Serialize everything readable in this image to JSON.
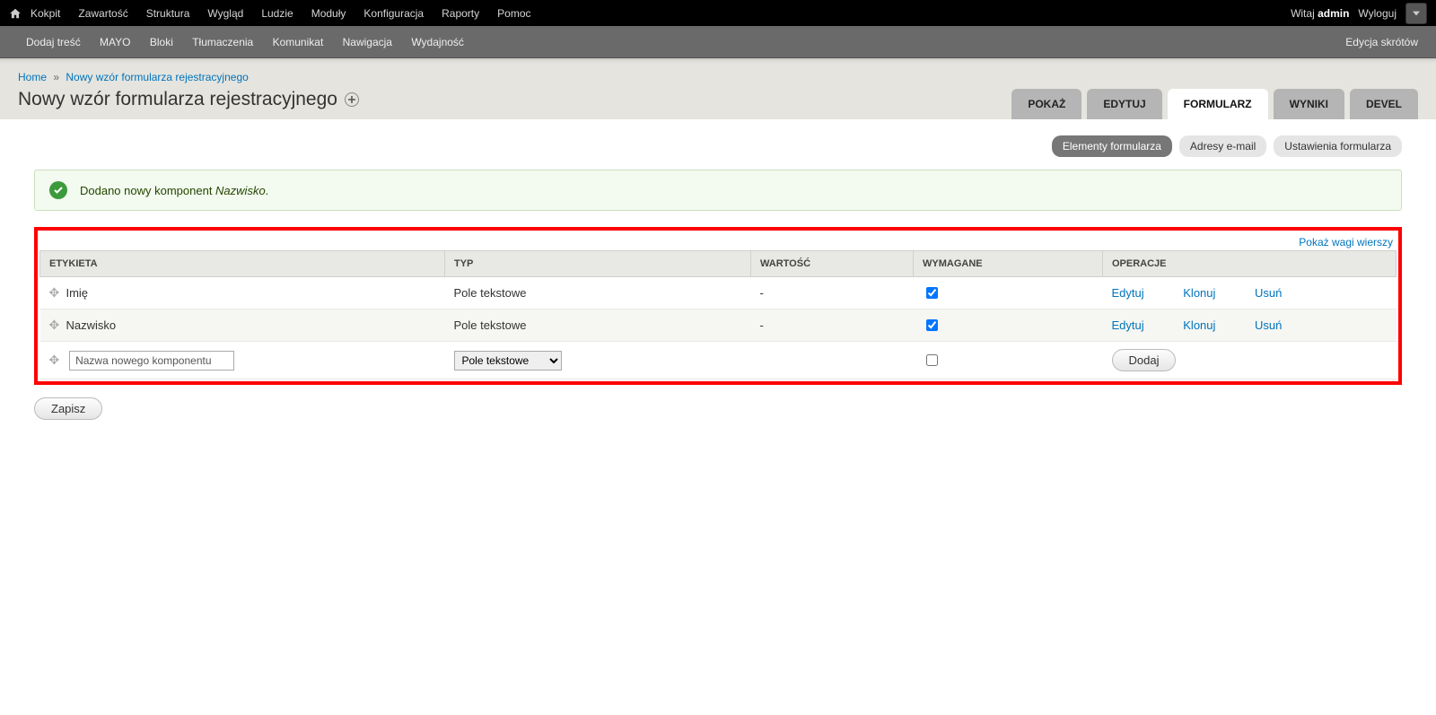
{
  "topmenu": [
    "Kokpit",
    "Zawartość",
    "Struktura",
    "Wygląd",
    "Ludzie",
    "Moduły",
    "Konfiguracja",
    "Raporty",
    "Pomoc"
  ],
  "user": {
    "welcome": "Witaj",
    "name": "admin",
    "logout": "Wyloguj"
  },
  "shortcuts": {
    "items": [
      "Dodaj treść",
      "MAYO",
      "Bloki",
      "Tłumaczenia",
      "Komunikat",
      "Nawigacja",
      "Wydajność"
    ],
    "edit": "Edycja skrótów"
  },
  "breadcrumb": {
    "home": "Home",
    "sep": "»",
    "current": "Nowy wzór formularza rejestracyjnego"
  },
  "page_title": "Nowy wzór formularza rejestracyjnego",
  "primary_tabs": [
    {
      "label": "POKAŻ"
    },
    {
      "label": "EDYTUJ"
    },
    {
      "label": "FORMULARZ",
      "active": true
    },
    {
      "label": "WYNIKI"
    },
    {
      "label": "DEVEL"
    }
  ],
  "secondary_tabs": [
    {
      "label": "Elementy formularza",
      "active": true
    },
    {
      "label": "Adresy e-mail"
    },
    {
      "label": "Ustawienia formularza"
    }
  ],
  "status": {
    "prefix": "Dodano nowy komponent ",
    "name": "Nazwisko",
    "suffix": "."
  },
  "toggle_weights": "Pokaż wagi wierszy",
  "columns": {
    "label": "ETYKIETA",
    "type": "TYP",
    "value": "WARTOŚĆ",
    "required": "WYMAGANE",
    "ops": "OPERACJE"
  },
  "rows": [
    {
      "label": "Imię",
      "type": "Pole tekstowe",
      "value": "-",
      "required": true
    },
    {
      "label": "Nazwisko",
      "type": "Pole tekstowe",
      "value": "-",
      "required": true
    }
  ],
  "ops": {
    "edit": "Edytuj",
    "clone": "Klonuj",
    "delete": "Usuń"
  },
  "newrow": {
    "placeholder": "Nazwa nowego komponentu",
    "type_option": "Pole tekstowe",
    "add": "Dodaj"
  },
  "save": "Zapisz"
}
